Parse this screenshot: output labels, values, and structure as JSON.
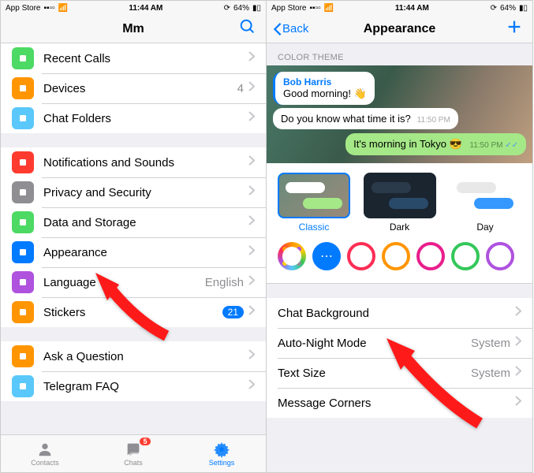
{
  "status": {
    "carrier": "App Store",
    "signal": "••ıı",
    "wifi": "⬆",
    "time": "11:44 AM",
    "lock": "⊘",
    "battery_pct": "64%",
    "battery_icon": "▭"
  },
  "left": {
    "title": "Mm",
    "rows1": [
      {
        "icon": "#4cd964",
        "name": "recent-calls",
        "label": "Recent Calls"
      },
      {
        "icon": "#ff9500",
        "name": "devices",
        "label": "Devices",
        "value": "4"
      },
      {
        "icon": "#5ac8fa",
        "name": "chat-folders",
        "label": "Chat Folders"
      }
    ],
    "rows2": [
      {
        "icon": "#ff3b30",
        "name": "notifications",
        "label": "Notifications and Sounds"
      },
      {
        "icon": "#8e8e93",
        "name": "privacy",
        "label": "Privacy and Security"
      },
      {
        "icon": "#4cd964",
        "name": "data",
        "label": "Data and Storage"
      },
      {
        "icon": "#007aff",
        "name": "appearance",
        "label": "Appearance"
      },
      {
        "icon": "#af52de",
        "name": "language",
        "label": "Language",
        "value": "English"
      },
      {
        "icon": "#ff9500",
        "name": "stickers",
        "label": "Stickers",
        "badge": "21"
      }
    ],
    "rows3": [
      {
        "icon": "#ff9500",
        "name": "ask",
        "label": "Ask a Question"
      },
      {
        "icon": "#5ac8fa",
        "name": "faq",
        "label": "Telegram FAQ"
      }
    ],
    "tabs": [
      {
        "name": "contacts",
        "label": "Contacts"
      },
      {
        "name": "chats",
        "label": "Chats",
        "badge": "5"
      },
      {
        "name": "settings",
        "label": "Settings",
        "active": true
      }
    ]
  },
  "right": {
    "back": "Back",
    "title": "Appearance",
    "section_header": "COLOR THEME",
    "preview": {
      "sender": "Bob Harris",
      "msg1": "Good morning! 👋",
      "msg2": "Do you know what time it is?",
      "time_in": "11:50 PM",
      "msg_out": "It's morning in Tokyo 😎",
      "time_out": "11:50 PM"
    },
    "themes": [
      {
        "name": "Classic",
        "cls": "classic-bg",
        "selected": true
      },
      {
        "name": "Dark",
        "cls": "dark-bg"
      },
      {
        "name": "Day",
        "cls": "day-bg"
      }
    ],
    "rows": [
      {
        "name": "chat-bg",
        "label": "Chat Background"
      },
      {
        "name": "auto-night",
        "label": "Auto-Night Mode",
        "value": "System"
      },
      {
        "name": "text-size",
        "label": "Text Size",
        "value": "System"
      },
      {
        "name": "corners",
        "label": "Message Corners"
      }
    ]
  }
}
